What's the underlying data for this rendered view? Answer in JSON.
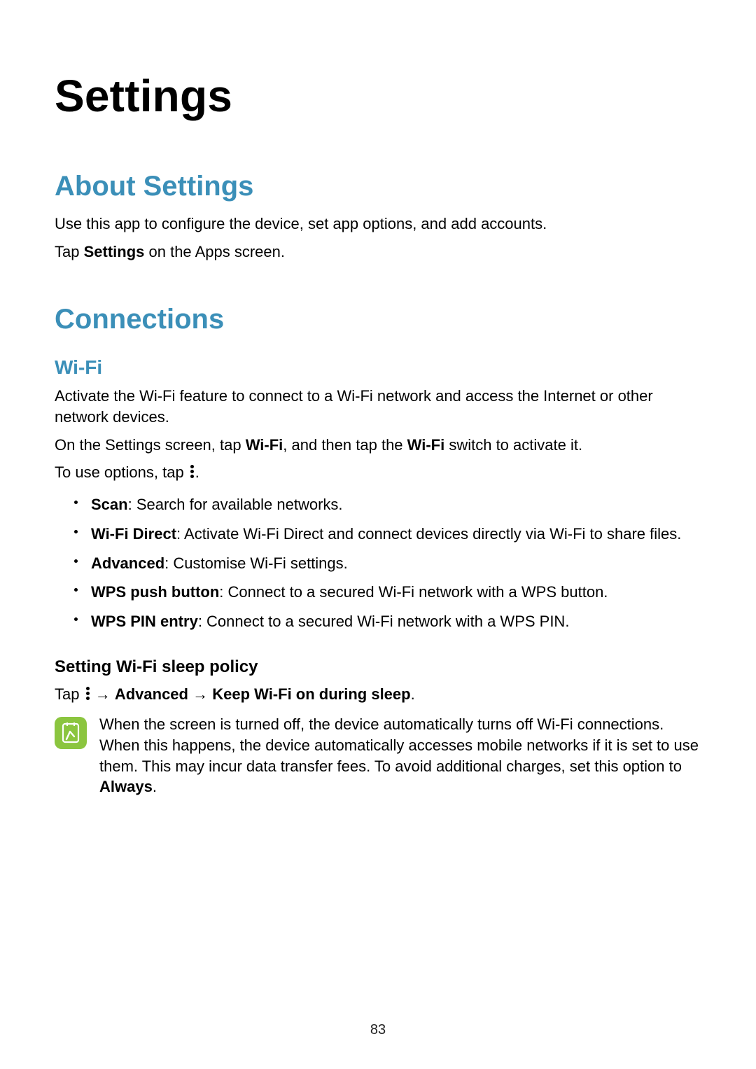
{
  "title": "Settings",
  "about": {
    "heading": "About Settings",
    "line1": "Use this app to configure the device, set app options, and add accounts.",
    "line2_pre": "Tap ",
    "line2_bold": "Settings",
    "line2_post": " on the Apps screen."
  },
  "connections": {
    "heading": "Connections",
    "wifi": {
      "heading": "Wi-Fi",
      "p1": "Activate the Wi-Fi feature to connect to a Wi-Fi network and access the Internet or other network devices.",
      "p2_pre": "On the Settings screen, tap ",
      "p2_b1": "Wi-Fi",
      "p2_mid": ", and then tap the ",
      "p2_b2": "Wi-Fi",
      "p2_post": " switch to activate it.",
      "p3_pre": "To use options, tap ",
      "p3_post": ".",
      "options": [
        {
          "label": "Scan",
          "desc": ": Search for available networks."
        },
        {
          "label": "Wi-Fi Direct",
          "desc": ": Activate Wi-Fi Direct and connect devices directly via Wi-Fi to share files."
        },
        {
          "label": "Advanced",
          "desc": ": Customise Wi-Fi settings."
        },
        {
          "label": "WPS push button",
          "desc": ": Connect to a secured Wi-Fi network with a WPS button."
        },
        {
          "label": "WPS PIN entry",
          "desc": ": Connect to a secured Wi-Fi network with a WPS PIN."
        }
      ],
      "sleep": {
        "heading": "Setting Wi-Fi sleep policy",
        "line_pre": "Tap ",
        "arrow1": " → ",
        "b1": "Advanced",
        "arrow2": " → ",
        "b2": "Keep Wi-Fi on during sleep",
        "line_post": ".",
        "note_pre": "When the screen is turned off, the device automatically turns off Wi-Fi connections. When this happens, the device automatically accesses mobile networks if it is set to use them. This may incur data transfer fees. To avoid additional charges, set this option to ",
        "note_bold": "Always",
        "note_post": "."
      }
    }
  },
  "page_number": "83"
}
